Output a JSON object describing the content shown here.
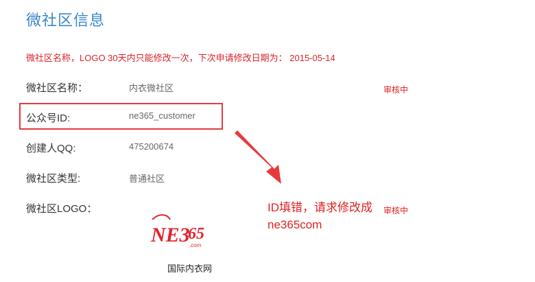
{
  "page": {
    "title": "微社区信息",
    "notice": "微社区名称，LOGO 30天内只能修改一次，下次申请修改日期为： 2015-05-14"
  },
  "fields": [
    {
      "label": "微社区名称：",
      "value": "内衣微社区"
    },
    {
      "label": "公众号ID:",
      "value": "ne365_customer"
    },
    {
      "label": "创建人QQ:",
      "value": "475200674"
    },
    {
      "label": "微社区类型:",
      "value": "普通社区"
    },
    {
      "label": "微社区LOGO：",
      "value": ""
    }
  ],
  "statuses": {
    "name_status": "审核中",
    "logo_status": "审核中"
  },
  "annotation": {
    "line1": "ID填错，请求修改成",
    "line2": "ne365com"
  },
  "logo": {
    "text_ne": "NE3",
    "text_65": "65",
    "text_com": ".com",
    "caption": "国际内衣网",
    "brand_color": "#e0252c"
  },
  "colors": {
    "title": "#3a86c8",
    "notice": "#d9242a",
    "highlight": "#e23b3b"
  }
}
